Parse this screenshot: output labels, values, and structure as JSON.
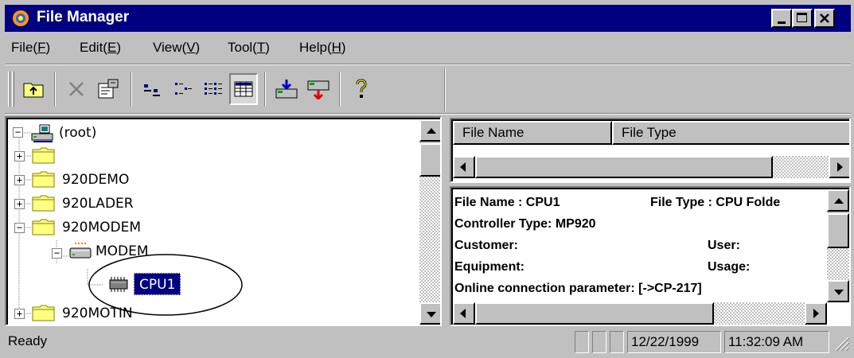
{
  "window": {
    "title": "File Manager",
    "controls": [
      "minimize",
      "maximize",
      "close"
    ]
  },
  "menubar": [
    {
      "label": "File(",
      "key": "F",
      "suffix": ")"
    },
    {
      "label": "Edit(",
      "key": "E",
      "suffix": ")"
    },
    {
      "label": "View(",
      "key": "V",
      "suffix": ")"
    },
    {
      "label": "Tool(",
      "key": "T",
      "suffix": ")"
    },
    {
      "label": "Help(",
      "key": "H",
      "suffix": ")"
    }
  ],
  "toolbar": {
    "buttons": [
      "up-folder-icon",
      "delete-icon",
      "properties-icon",
      "large-icons-icon",
      "small-icons-icon",
      "list-icon",
      "details-icon",
      "download-icon",
      "upload-icon",
      "help-icon"
    ],
    "active": "details-icon"
  },
  "tree": {
    "items": [
      {
        "label": "(root)",
        "icon": "network-drive-icon",
        "expander": "−"
      },
      {
        "label": "",
        "icon": "folder-icon",
        "expander": "+"
      },
      {
        "label": "920DEMO",
        "icon": "folder-icon",
        "expander": "+"
      },
      {
        "label": "920LADER",
        "icon": "folder-icon",
        "expander": "+"
      },
      {
        "label": "920MODEM",
        "icon": "folder-icon",
        "expander": "−"
      },
      {
        "label": "MODEM",
        "icon": "modem-icon",
        "expander": "−"
      },
      {
        "label": "CPU1",
        "icon": "cpu-chip-icon",
        "selected": true
      },
      {
        "label": "920MOTIN",
        "icon": "folder-icon",
        "expander": "+"
      }
    ]
  },
  "filelist": {
    "columns": [
      "File Name",
      "File Type"
    ]
  },
  "info": {
    "line1_left": "File Name : CPU1",
    "line1_right": "File Type : CPU Folde",
    "line2": "Controller Type: MP920",
    "line3_left": "Customer:",
    "line3_right": "User:",
    "line4_left": "Equipment:",
    "line4_right": "Usage:",
    "line5": "Online connection parameter: [->CP-217]"
  },
  "status": {
    "message": "Ready",
    "date": "12/22/1999",
    "time": "11:32:09 AM"
  },
  "colors": {
    "titlebar": "#000080",
    "face": "#c0c0c0",
    "selection": "#000080",
    "folder": "#ffff80"
  }
}
